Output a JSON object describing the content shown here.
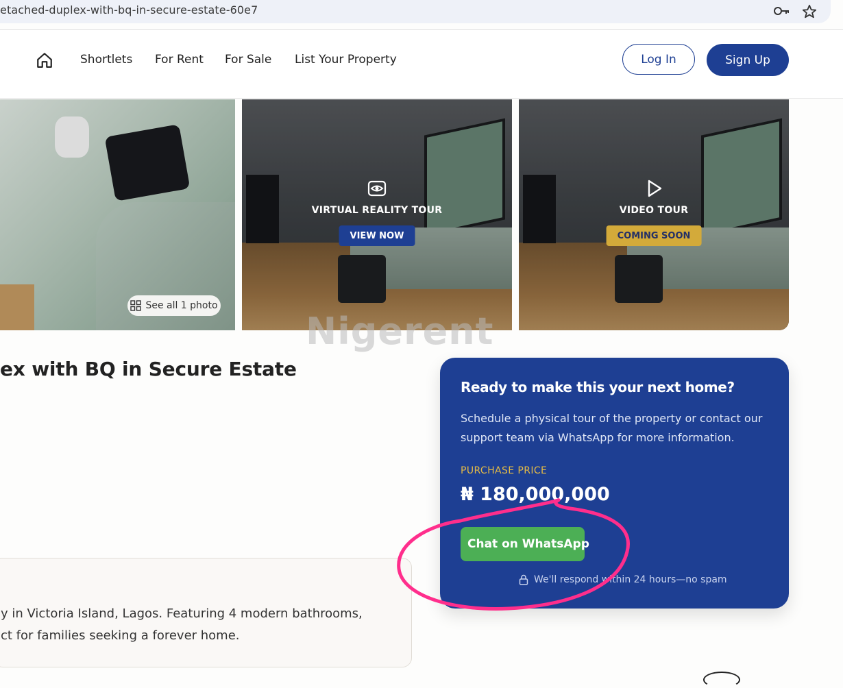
{
  "browser": {
    "url": "etached-duplex-with-bq-in-secure-estate-60e7",
    "icons": [
      "key-icon",
      "star-icon"
    ]
  },
  "nav": {
    "home_icon": "home-icon",
    "links": [
      "Shortlets",
      "For Rent",
      "For Sale",
      "List Your Property"
    ],
    "login": "Log In",
    "signup": "Sign Up"
  },
  "gallery": {
    "see_all": "See all 1 photo",
    "vr_tour": {
      "title": "VIRTUAL REALITY TOUR",
      "button": "VIEW NOW",
      "icon": "vr-eye-icon"
    },
    "video_tour": {
      "title": "VIDEO TOUR",
      "button": "COMING SOON",
      "icon": "play-icon"
    }
  },
  "watermark": "Nigerent",
  "property": {
    "title": "ex with BQ in Secure Estate",
    "description_lines": [
      "y in Victoria Island, Lagos. Featuring 4 modern bathrooms,",
      "ct for families seeking a forever home."
    ]
  },
  "cta": {
    "title": "Ready to make this your next home?",
    "subtitle_lines": [
      "Schedule a physical tour of the property or contact our",
      "support team via WhatsApp for more information."
    ],
    "price_label": "PURCHASE PRICE",
    "price": "₦ 180,000,000",
    "whatsapp_button": "Chat on WhatsApp",
    "note": "We'll respond within 24 hours—no spam"
  },
  "colors": {
    "brand_blue": "#1e3f93",
    "gold": "#d3aa3a",
    "whatsapp_green": "#4caf55",
    "annotation_pink": "#ff2e8c"
  }
}
